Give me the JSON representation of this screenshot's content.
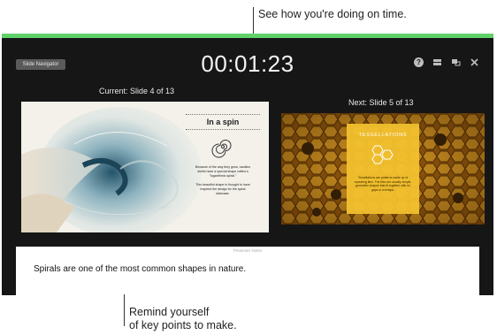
{
  "callouts": {
    "top": "See how you're doing on time.",
    "bottom_line1": "Remind yourself",
    "bottom_line2": "of key points to make."
  },
  "window": {
    "accent_color": "#5fd36a",
    "nav_button": "Slide Navigator",
    "timer": "00:01:23",
    "icons": [
      "help-icon",
      "layout-icon",
      "display-icon",
      "close-icon"
    ]
  },
  "current": {
    "label": "Current: Slide 4 of 13",
    "title": "In a spin",
    "body1": "Because of the way they grow, nautilus shells have a special shape called a \"logarithmic spiral.\"",
    "body2": "This beautiful shape is thought to have inspired the design for the spiral staircase."
  },
  "next": {
    "label": "Next: Slide 5 of 13",
    "title": "TESSELLATIONS",
    "body": "Tessellations are patterns made up of repeating tiles. The tiles are usually simple, geometric shapes that fit together with no gaps or overlaps."
  },
  "notes": {
    "header": "Presenter Notes",
    "text": "Spirals are one of the most common shapes in nature."
  }
}
